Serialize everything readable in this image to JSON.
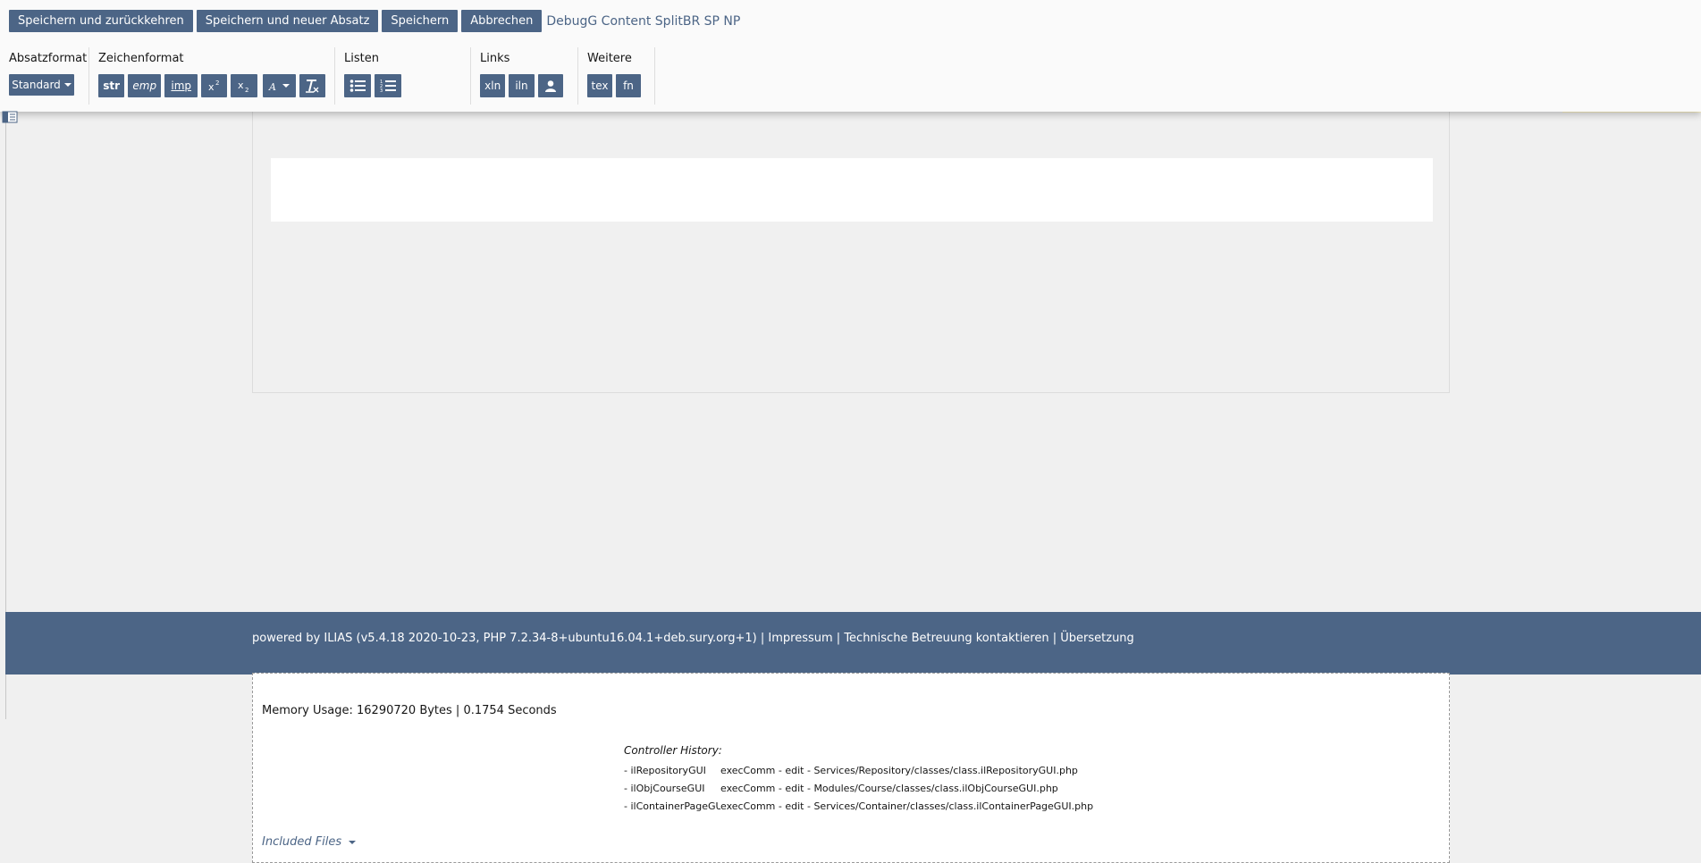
{
  "toolbar": {
    "actions": {
      "save_return": "Speichern und zurückkehren",
      "save_new": "Speichern und neuer Absatz",
      "save": "Speichern",
      "cancel": "Abbrechen"
    },
    "page_title": "DebugG Content SplitBR SP NP",
    "groups": {
      "paragraph": {
        "label": "Absatzformat",
        "style_value": "Standard"
      },
      "character": {
        "label": "Zeichenformat",
        "str": "str",
        "emp": "emp",
        "imp": "imp"
      },
      "lists": {
        "label": "Listen"
      },
      "links": {
        "label": "Links",
        "xln": "xln",
        "iln": "iln"
      },
      "more": {
        "label": "Weitere",
        "tex": "tex",
        "fn": "fn"
      }
    }
  },
  "footer": {
    "powered": "powered by ILIAS (v5.4.18 2020-10-23, PHP 7.2.34-8+ubuntu16.04.1+deb.sury.org+1)",
    "sep": " | ",
    "impressum": "Impressum",
    "support": "Technische Betreuung kontaktieren",
    "translation": "Übersetzung"
  },
  "debug": {
    "memory": "Memory Usage: 16290720 Bytes | 0.1754 Seconds",
    "controller_title": "Controller History:",
    "rows": [
      {
        "cls": "- ilRepositoryGUI",
        "info": "execComm - edit - Services/Repository/classes/class.ilRepositoryGUI.php"
      },
      {
        "cls": "- ilObjCourseGUI",
        "info": "execComm - edit - Modules/Course/classes/class.ilObjCourseGUI.php"
      },
      {
        "cls": "- ilContainerPageGUI",
        "info": "execComm - edit - Services/Container/classes/class.ilContainerPageGUI.php"
      }
    ],
    "included_files": "Included Files"
  },
  "colors": {
    "primary": "#4c6586",
    "background": "#f0f0f0"
  }
}
